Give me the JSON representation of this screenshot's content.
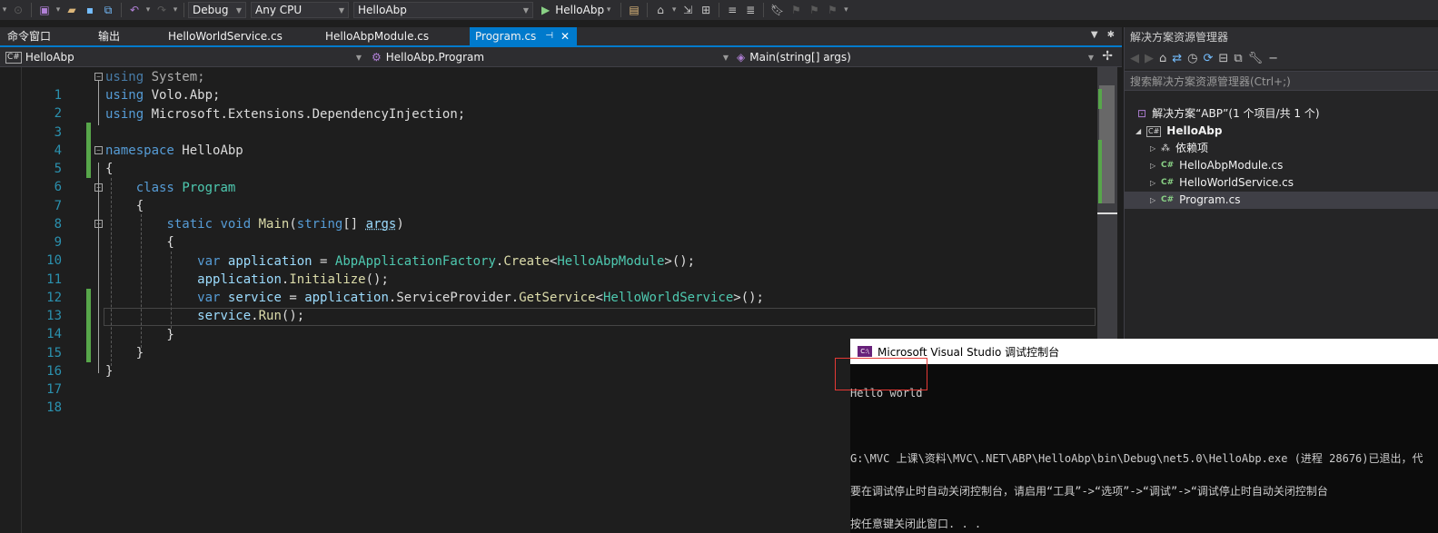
{
  "toolbar": {
    "config": "Debug",
    "platform": "Any CPU",
    "startup_project": "HelloAbp",
    "run_label": "HelloAbp"
  },
  "tabs": {
    "command_window": "命令窗口",
    "output": "输出",
    "files": [
      "HelloWorldService.cs",
      "HelloAbpModule.cs"
    ],
    "active": "Program.cs"
  },
  "navbar": {
    "project": "HelloAbp",
    "type": "HelloAbp.Program",
    "member": "Main(string[] args)"
  },
  "editor": {
    "line_numbers": [
      "1",
      "2",
      "3",
      "4",
      "5",
      "6",
      "7",
      "8",
      "9",
      "10",
      "11",
      "12",
      "13",
      "14",
      "15",
      "16",
      "17",
      "18"
    ],
    "current_line": 14,
    "tokens": {
      "using": "using",
      "system": "System",
      "volo": "Volo",
      "abp": "Abp",
      "microsoft": "Microsoft",
      "extensions": "Extensions",
      "di": "DependencyInjection",
      "namespace": "namespace",
      "helloabp": "HelloAbp",
      "class": "class",
      "program": "Program",
      "static": "static",
      "void": "void",
      "main": "Main",
      "string": "string",
      "args": "args",
      "var": "var",
      "application": "application",
      "factory": "AbpApplicationFactory",
      "create": "Create",
      "module": "HelloAbpModule",
      "initialize": "Initialize",
      "service": "service",
      "service_provider": "ServiceProvider",
      "get_service": "GetService",
      "hello_world_service": "HelloWorldService",
      "run": "Run"
    }
  },
  "solution_explorer": {
    "title": "解决方案资源管理器",
    "search_placeholder": "搜索解决方案资源管理器(Ctrl+;)",
    "solution": "解决方案“ABP”(1 个项目/共 1 个)",
    "project": "HelloAbp",
    "items": [
      "依赖项",
      "HelloAbpModule.cs",
      "HelloWorldService.cs",
      "Program.cs"
    ]
  },
  "console": {
    "title": "Microsoft Visual Studio 调试控制台",
    "lines": [
      "Hello world",
      "",
      "G:\\MVC 上课\\资料\\MVC\\.NET\\ABP\\HelloAbp\\bin\\Debug\\net5.0\\HelloAbp.exe (进程 28676)已退出，代",
      "要在调试停止时自动关闭控制台，请启用“工具”->“选项”->“调试”->“调试停止时自动关闭控制台",
      "按任意键关闭此窗口. . ."
    ]
  }
}
